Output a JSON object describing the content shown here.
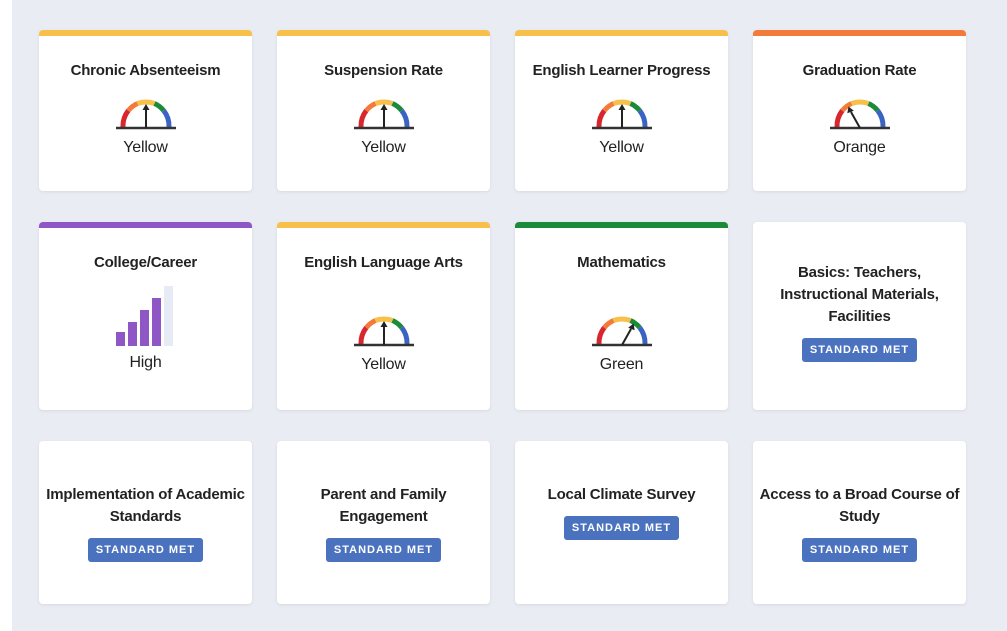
{
  "colors": {
    "yellow": "#f7c04a",
    "orange": "#f47a3a",
    "purple": "#8f57c5",
    "green": "#1b8b3a",
    "badge": "#4a72bf"
  },
  "cards": [
    {
      "title": "Chronic Absenteeism",
      "status": "Yellow"
    },
    {
      "title": "Suspension Rate",
      "status": "Yellow"
    },
    {
      "title": "English Learner Progress",
      "status": "Yellow"
    },
    {
      "title": "Graduation Rate",
      "status": "Orange"
    },
    {
      "title": "College/Career",
      "status": "High"
    },
    {
      "title": "English Language Arts",
      "status": "Yellow"
    },
    {
      "title": "Mathematics",
      "status": "Green"
    },
    {
      "title_lines": [
        "Basics: Teachers,",
        "Instructional Materials,",
        "Facilities"
      ],
      "badge": "STANDARD MET"
    },
    {
      "title_lines": [
        "Implementation of Academic",
        "Standards"
      ],
      "badge": "STANDARD MET"
    },
    {
      "title_lines": [
        "Parent and Family",
        "Engagement"
      ],
      "badge": "STANDARD MET"
    },
    {
      "title": "Local Climate Survey",
      "badge": "STANDARD MET"
    },
    {
      "title_lines": [
        "Access to a Broad Course of",
        "Study"
      ],
      "badge": "STANDARD MET"
    }
  ]
}
